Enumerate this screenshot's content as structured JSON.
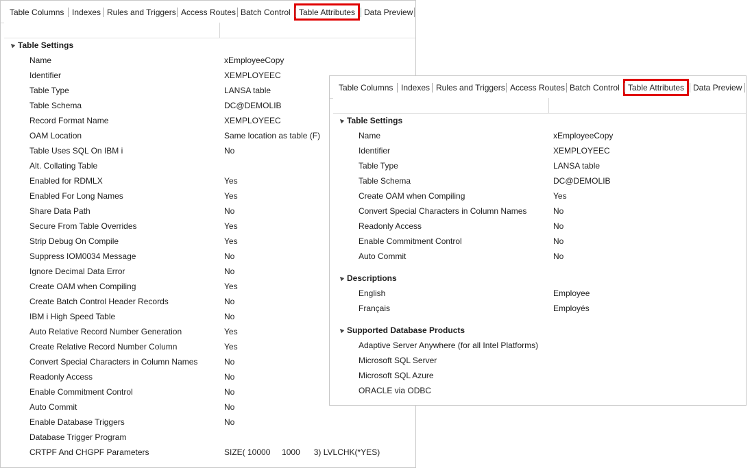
{
  "back_panel": {
    "tabs": [
      "Table Columns",
      "Indexes",
      "Rules and Triggers",
      "Access Routes",
      "Batch Control",
      "Table Attributes",
      "Data Preview"
    ],
    "active_tab": "Table Attributes",
    "groups": [
      {
        "title": "Table Settings",
        "rows": [
          {
            "label": "Name",
            "value": "xEmployeeCopy"
          },
          {
            "label": "Identifier",
            "value": "XEMPLOYEEC"
          },
          {
            "label": "Table Type",
            "value": "LANSA table"
          },
          {
            "label": "Table Schema",
            "value": "DC@DEMOLIB"
          },
          {
            "label": "Record Format Name",
            "value": "XEMPLOYEEC"
          },
          {
            "label": "OAM Location",
            "value": "Same location as table (F)"
          },
          {
            "label": "Table Uses SQL On IBM i",
            "value": "No"
          },
          {
            "label": "Alt. Collating Table",
            "value": ""
          },
          {
            "label": "Enabled for RDMLX",
            "value": "Yes"
          },
          {
            "label": "Enabled For Long Names",
            "value": "Yes"
          },
          {
            "label": "Share Data Path",
            "value": "No"
          },
          {
            "label": "Secure From Table Overrides",
            "value": "Yes"
          },
          {
            "label": "Strip Debug On Compile",
            "value": "Yes"
          },
          {
            "label": "Suppress IOM0034 Message",
            "value": "No"
          },
          {
            "label": "Ignore Decimal Data Error",
            "value": "No"
          },
          {
            "label": "Create OAM when Compiling",
            "value": "Yes"
          },
          {
            "label": "Create Batch Control Header Records",
            "value": "No"
          },
          {
            "label": "IBM i High Speed Table",
            "value": "No"
          },
          {
            "label": "Auto Relative Record Number Generation",
            "value": "Yes"
          },
          {
            "label": "Create Relative Record Number Column",
            "value": "Yes"
          },
          {
            "label": "Convert Special Characters in Column Names",
            "value": "No"
          },
          {
            "label": "Readonly Access",
            "value": "No"
          },
          {
            "label": "Enable Commitment Control",
            "value": "No"
          },
          {
            "label": "Auto Commit",
            "value": "No"
          },
          {
            "label": "Enable Database Triggers",
            "value": "No"
          },
          {
            "label": "Database Trigger Program",
            "value": ""
          },
          {
            "label": "CRTPF And CHGPF Parameters",
            "value": "SIZE( 10000     1000      3) LVLCHK(*YES)"
          }
        ]
      }
    ]
  },
  "front_panel": {
    "tabs": [
      "Table Columns",
      "Indexes",
      "Rules and Triggers",
      "Access Routes",
      "Batch Control",
      "Table Attributes",
      "Data Preview"
    ],
    "active_tab": "Table Attributes",
    "groups": [
      {
        "title": "Table Settings",
        "rows": [
          {
            "label": "Name",
            "value": "xEmployeeCopy"
          },
          {
            "label": "Identifier",
            "value": "XEMPLOYEEC"
          },
          {
            "label": "Table Type",
            "value": "LANSA table"
          },
          {
            "label": "Table Schema",
            "value": "DC@DEMOLIB"
          },
          {
            "label": "Create OAM when Compiling",
            "value": "Yes"
          },
          {
            "label": "Convert Special Characters in Column Names",
            "value": "No"
          },
          {
            "label": "Readonly Access",
            "value": "No"
          },
          {
            "label": "Enable Commitment Control",
            "value": "No"
          },
          {
            "label": "Auto Commit",
            "value": "No"
          }
        ]
      },
      {
        "title": "Descriptions",
        "rows": [
          {
            "label": "English",
            "value": "Employee"
          },
          {
            "label": "Français",
            "value": "Employés"
          }
        ]
      },
      {
        "title": "Supported Database Products",
        "rows": [
          {
            "label": "Adaptive Server Anywhere (for all Intel Platforms)",
            "value": ""
          },
          {
            "label": "Microsoft SQL Server",
            "value": ""
          },
          {
            "label": "Microsoft SQL Azure",
            "value": ""
          },
          {
            "label": "ORACLE via ODBC",
            "value": ""
          }
        ]
      }
    ]
  },
  "colors": {
    "active_tab_outline": "#e00000",
    "panel_border": "#c8c8c8",
    "text": "#1e1e1e"
  }
}
